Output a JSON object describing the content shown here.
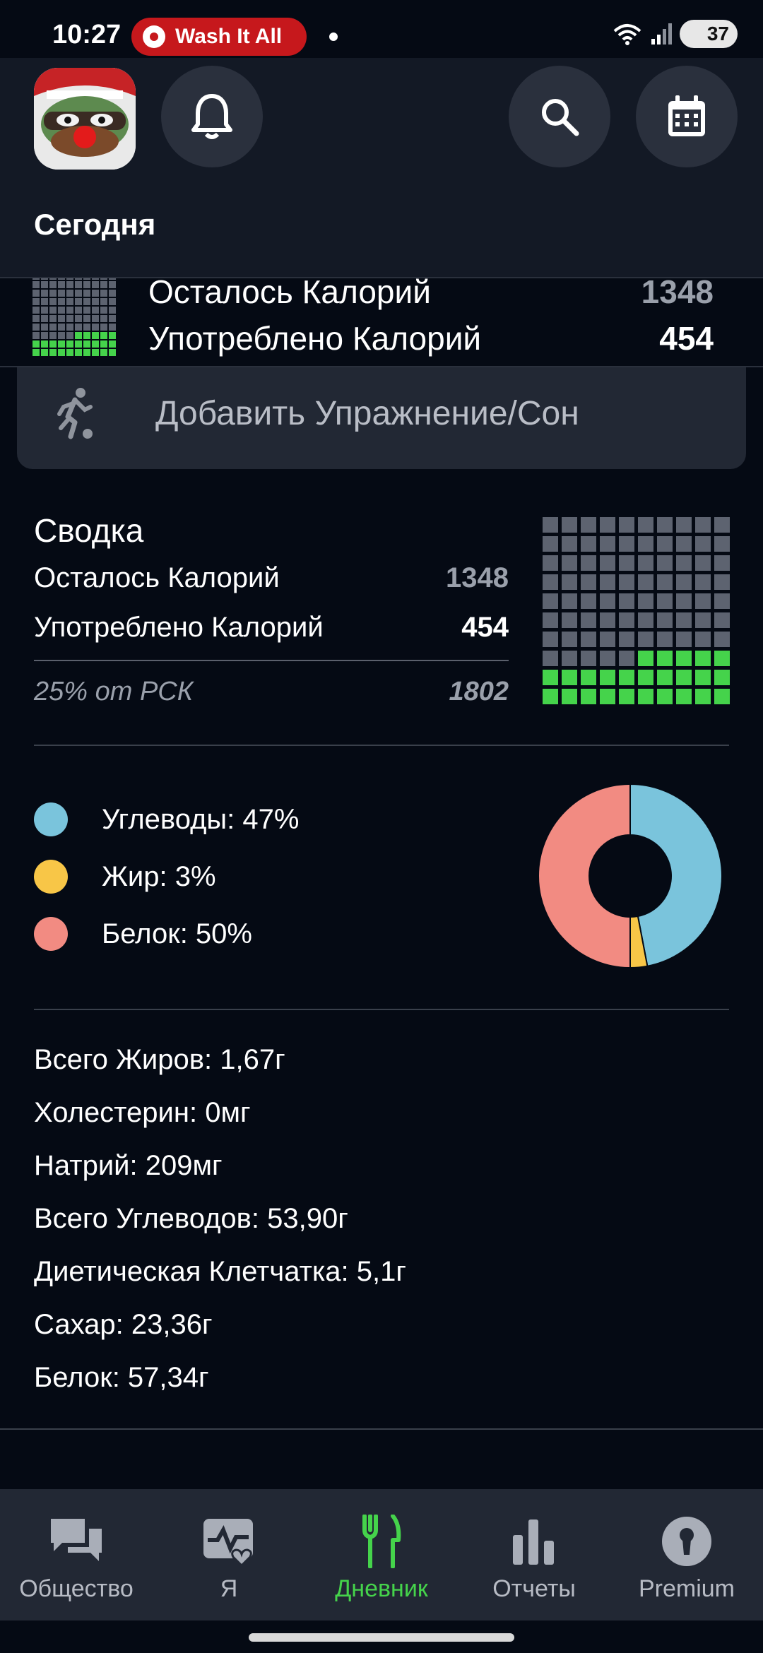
{
  "status_bar": {
    "time": "10:27",
    "recording_pill": "Wash It All",
    "battery": "37"
  },
  "header": {
    "title": "Сегодня"
  },
  "calorie_strip": {
    "remaining_label": "Осталось Калорий",
    "remaining_value": "1348",
    "consumed_label": "Употреблено Калорий",
    "consumed_value": "454"
  },
  "add_exercise": {
    "label": "Добавить Упражнение/Сон"
  },
  "summary": {
    "title": "Сводка",
    "remaining_label": "Осталось Калорий",
    "remaining_value": "1348",
    "consumed_label": "Употреблено Калорий",
    "consumed_value": "454",
    "rsk_label": "25% от РСК",
    "rsk_value": "1802",
    "grid_filled_fraction": 0.25
  },
  "macros": {
    "items": [
      {
        "label": "Углеводы: 47%",
        "percent": 47,
        "color": "#7ac4dc"
      },
      {
        "label": "Жир: 3%",
        "percent": 3,
        "color": "#f8c647"
      },
      {
        "label": "Белок: 50%",
        "percent": 50,
        "color": "#f28b82"
      }
    ]
  },
  "nutrients": [
    "Всего Жиров: 1,67г",
    "Холестерин: 0мг",
    "Натрий: 209мг",
    "Всего Углеводов: 53,90г",
    "Диетическая Клетчатка: 5,1г",
    "Сахар: 23,36г",
    "Белок: 57,34г"
  ],
  "bottom_nav": {
    "items": [
      {
        "label": "Общество",
        "icon": "community-icon"
      },
      {
        "label": "Я",
        "icon": "health-icon"
      },
      {
        "label": "Дневник",
        "icon": "diary-icon"
      },
      {
        "label": "Отчеты",
        "icon": "reports-icon"
      },
      {
        "label": "Premium",
        "icon": "premium-icon"
      }
    ],
    "active": "Дневник"
  },
  "colors": {
    "background": "#050a14",
    "header": "#131925",
    "accent_green": "#45d34b",
    "grid_empty": "#5d6370",
    "card": "#222834"
  }
}
